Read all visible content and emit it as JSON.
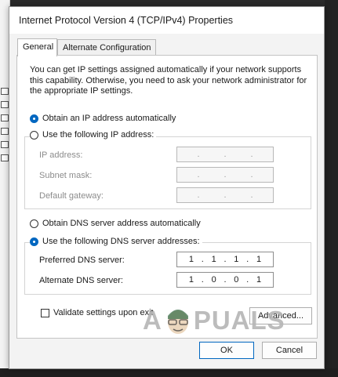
{
  "dialog": {
    "title": "Internet Protocol Version 4 (TCP/IPv4) Properties",
    "tabs": [
      {
        "label": "General",
        "active": true
      },
      {
        "label": "Alternate Configuration",
        "active": false
      }
    ],
    "description": "You can get IP settings assigned automatically if your network supports this capability. Otherwise, you need to ask your network administrator for the appropriate IP settings.",
    "ip": {
      "auto_label": "Obtain an IP address automatically",
      "auto_selected": true,
      "manual_label": "Use the following IP address:",
      "fields": [
        {
          "label": "IP address:",
          "value": [
            ".",
            ".",
            "."
          ]
        },
        {
          "label": "Subnet mask:",
          "value": [
            ".",
            ".",
            "."
          ]
        },
        {
          "label": "Default gateway:",
          "value": [
            ".",
            ".",
            "."
          ]
        }
      ]
    },
    "dns": {
      "auto_label": "Obtain DNS server address automatically",
      "manual_label": "Use the following DNS server addresses:",
      "manual_selected": true,
      "preferred_label": "Preferred DNS server:",
      "preferred_octets": [
        "1",
        "1",
        "1",
        "1"
      ],
      "alternate_label": "Alternate DNS server:",
      "alternate_octets": [
        "1",
        "0",
        "0",
        "1"
      ]
    },
    "validate_label": "Validate settings upon exit",
    "advanced_label": "Advanced...",
    "ok_label": "OK",
    "cancel_label": "Cancel"
  },
  "watermark": {
    "text_left": "A",
    "text_right": "PUALS"
  },
  "colors": {
    "accent": "#0067c0",
    "dialog_bg": "#f3f3f3",
    "panel_bg": "#ffffff"
  }
}
